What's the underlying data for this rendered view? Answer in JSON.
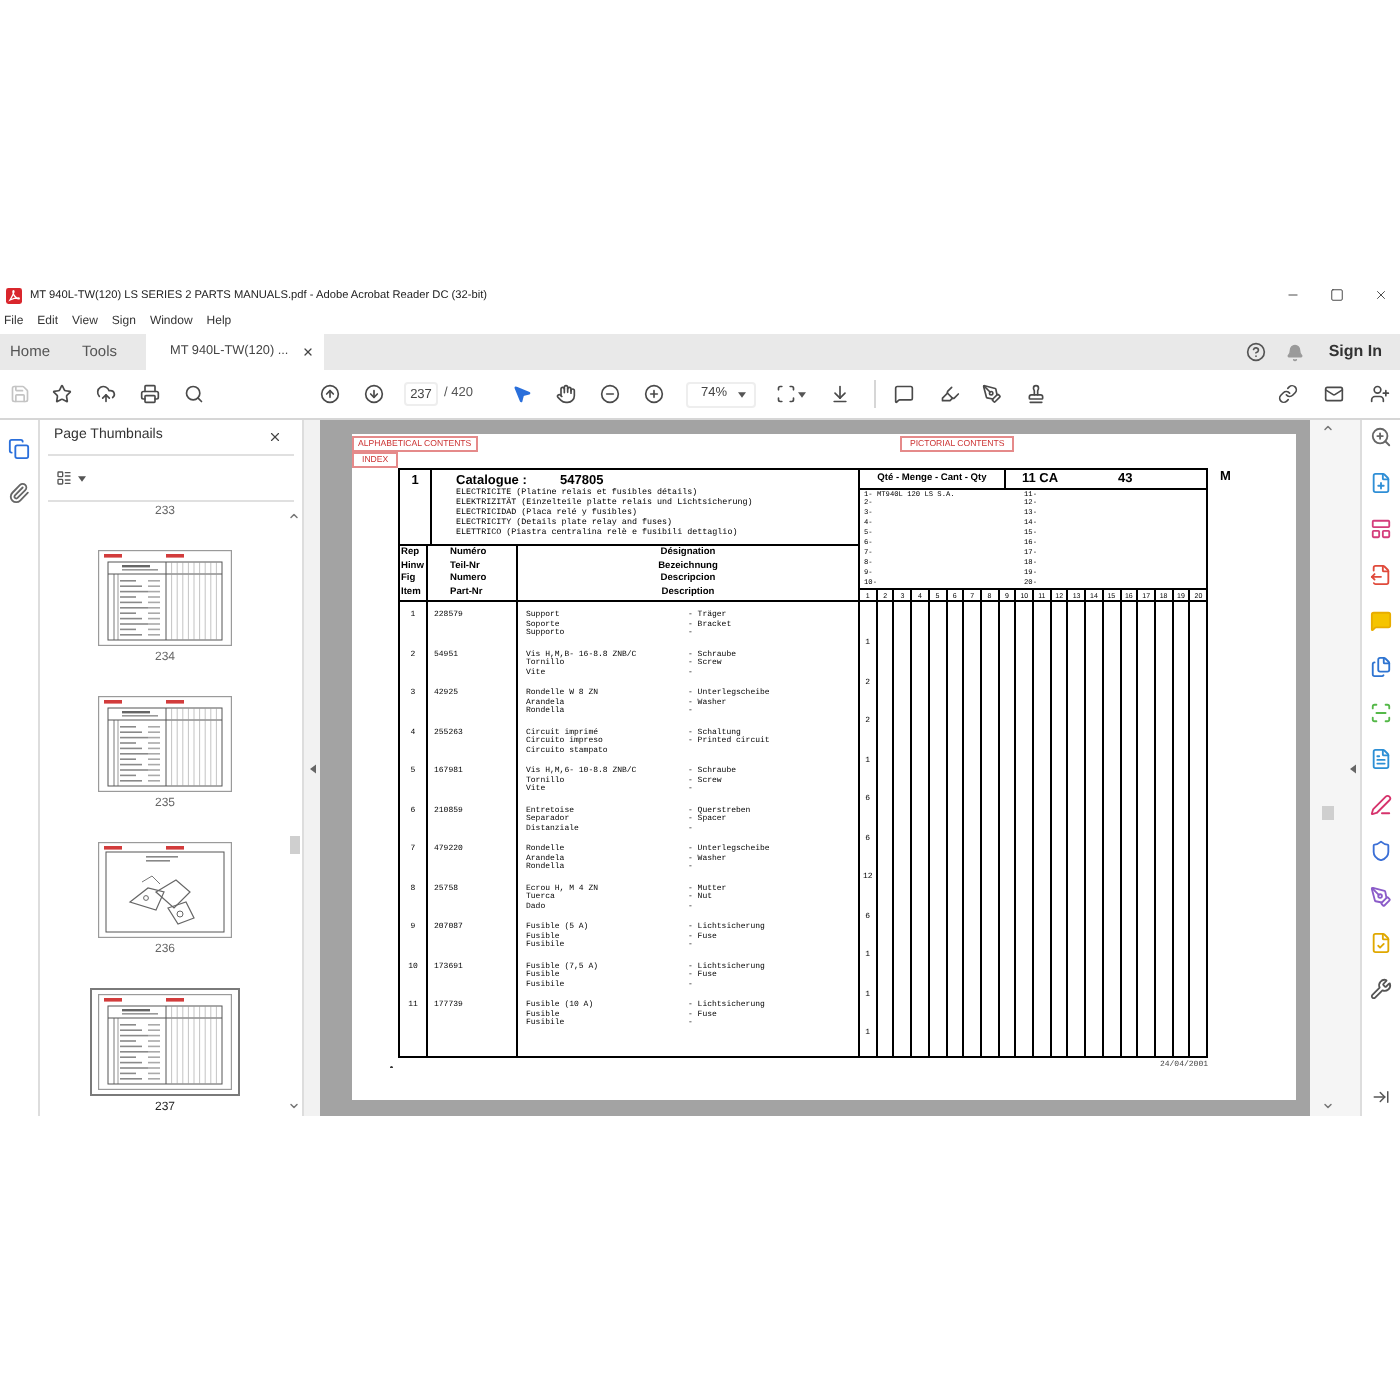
{
  "window": {
    "title": "MT 940L-TW(120) LS SERIES 2 PARTS MANUALS.pdf - Adobe Acrobat Reader DC (32-bit)"
  },
  "menu": [
    "File",
    "Edit",
    "View",
    "Sign",
    "Window",
    "Help"
  ],
  "tabs": [
    {
      "label": "Home",
      "kind": "home",
      "selected": false
    },
    {
      "label": "Tools",
      "kind": "tools",
      "selected": false
    },
    {
      "label": "MT 940L-TW(120) ...",
      "kind": "document",
      "selected": true
    }
  ],
  "account": {
    "sign_in": "Sign In"
  },
  "toolbar": {
    "save_disabled": true,
    "page_current": "237",
    "page_total": "/ 420",
    "zoom": "74%",
    "tools": [
      {
        "kind": "select",
        "selected": true
      },
      {
        "kind": "hand",
        "selected": false
      }
    ]
  },
  "sidebar": {
    "title": "Page Thumbnails",
    "thumbnails": [
      {
        "page": "233",
        "kind": "label-only",
        "selected": false
      },
      {
        "page": "234",
        "kind": "parts-list",
        "selected": false
      },
      {
        "page": "235",
        "kind": "parts-list",
        "selected": false
      },
      {
        "page": "236",
        "kind": "exploded-view",
        "selected": false
      },
      {
        "page": "237",
        "kind": "parts-list",
        "selected": true
      }
    ]
  },
  "document": {
    "alphabetical_link": "ALPHABETICAL CONTENTS",
    "index_link": "INDEX",
    "pictorial_link": "PICTORIAL CONTENTS",
    "group": "1",
    "catalogue_label": "Catalogue :",
    "catalogue_number": "547805",
    "titles": [
      "ELECTRICITE (Platine relais et fusibles détails)",
      "ELEKTRIZITÄT (Einzelteile platte relais und Lichtsicherung)",
      "ELECTRICIDAD (Placa relé y fusibles)",
      "ELECTRICITY (Details plate relay and fuses)",
      "ELETTRICO (Piastra centralina relè e fusibili dettaglio)"
    ],
    "quantity_heading": "Qté - Menge - Cant - Qty",
    "series_code": "11 CA",
    "series_number": "43",
    "corner_letter": "M",
    "models": [
      "1- MT940L 120 LS S.A.",
      "2-",
      "3-",
      "4-",
      "5-",
      "6-",
      "7-",
      "8-",
      "9-",
      "10-"
    ],
    "models_continued": [
      "11-",
      "12-",
      "13-",
      "14-",
      "15-",
      "16-",
      "17-",
      "18-",
      "19-",
      "20-"
    ],
    "quantity_columns": [
      "1",
      "2",
      "3",
      "4",
      "5",
      "6",
      "7",
      "8",
      "9",
      "10",
      "11",
      "12",
      "13",
      "14",
      "15",
      "16",
      "17",
      "18",
      "19",
      "20"
    ],
    "columns": [
      {
        "lines": [
          "Rep",
          "Hinw",
          "Fig",
          "Item"
        ]
      },
      {
        "lines": [
          "Numéro",
          "Teil-Nr",
          "Numero",
          "Part-Nr"
        ]
      },
      {
        "lines": [
          "Désignation",
          "Bezeichnung",
          "Descripcion",
          "Description"
        ]
      }
    ],
    "rows": [
      {
        "ref": "1",
        "part": "228579",
        "names": [
          "Support",
          "Soporte",
          "Supporto"
        ],
        "translations": [
          "- Träger",
          "- Bracket",
          "-"
        ],
        "qty": "1"
      },
      {
        "ref": "2",
        "part": "54951",
        "names": [
          "Vis H,M,B- 16-8.8 ZNB/C",
          "Tornillo",
          "Vite"
        ],
        "translations": [
          "- Schraube",
          "- Screw",
          "-"
        ],
        "qty": "2"
      },
      {
        "ref": "3",
        "part": "42925",
        "names": [
          "Rondelle W 8 ZN",
          "Arandela",
          "Rondella"
        ],
        "translations": [
          "- Unterlegscheibe",
          "- Washer",
          "-"
        ],
        "qty": "2"
      },
      {
        "ref": "4",
        "part": "255263",
        "names": [
          "Circuit imprimé",
          "Circuito impreso",
          "Circuito stampato"
        ],
        "translations": [
          "- Schaltung",
          "- Printed circuit"
        ],
        "qty": "1"
      },
      {
        "ref": "5",
        "part": "167981",
        "names": [
          "Vis H,M,6- 10-8.8 ZNB/C",
          "Tornillo",
          "Vite"
        ],
        "translations": [
          "- Schraube",
          "- Screw",
          "-"
        ],
        "qty": "6"
      },
      {
        "ref": "6",
        "part": "210859",
        "names": [
          "Entretoise",
          "Separador",
          "Distanziale"
        ],
        "translations": [
          "- Querstreben",
          "- Spacer",
          "-"
        ],
        "qty": "6"
      },
      {
        "ref": "7",
        "part": "479220",
        "names": [
          "Rondelle",
          "Arandela",
          "Rondella"
        ],
        "translations": [
          "- Unterlegscheibe",
          "- Washer",
          "-"
        ],
        "qty": "12"
      },
      {
        "ref": "8",
        "part": "25758",
        "names": [
          "Ecrou H, M 4 ZN",
          "Tuerca",
          "Dado"
        ],
        "translations": [
          "- Mutter",
          "- Nut",
          "-"
        ],
        "qty": "6"
      },
      {
        "ref": "9",
        "part": "207087",
        "names": [
          "Fusible (5 A)",
          "Fusible",
          "Fusibile"
        ],
        "translations": [
          "- Lichtsicherung",
          "- Fuse",
          "-"
        ],
        "qty": "1"
      },
      {
        "ref": "10",
        "part": "173691",
        "names": [
          "Fusible (7,5 A)",
          "Fusible",
          "Fusibile"
        ],
        "translations": [
          "- Lichtsicherung",
          "- Fuse",
          "-"
        ],
        "qty": "1"
      },
      {
        "ref": "11",
        "part": "177739",
        "names": [
          "Fusible (10 A)",
          "Fusible",
          "Fusibile"
        ],
        "translations": [
          "- Lichtsicherung",
          "- Fuse",
          "-"
        ],
        "qty": "1"
      }
    ],
    "date": "24/04/2001"
  }
}
